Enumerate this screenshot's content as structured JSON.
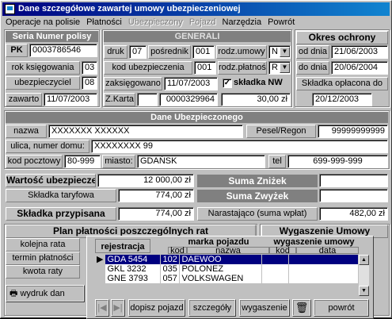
{
  "window": {
    "title": "Dane szczegółowe zawartej umowy ubezpieczeniowej"
  },
  "menu": [
    "Operacje na polisie",
    "Płatności",
    "Ubezpieczony",
    "Pojazd",
    "Narzędzia",
    "Powrót"
  ],
  "menu_disabled": [
    false,
    false,
    true,
    true,
    false,
    false
  ],
  "policy": {
    "header": "Seria Numer polisy",
    "series": "PK",
    "number": "0003786546",
    "rok_label": "rok księgowania",
    "rok": "03",
    "ubezp_label": "ubezpieczyciel",
    "ubezp": "08",
    "zawarto_label": "zawarto",
    "zawarto": "11/07/2003"
  },
  "general": {
    "header": "GENERALI",
    "druk_label": "druk",
    "druk": "07",
    "posrednik_label": "pośrednik",
    "posrednik": "001",
    "rodz_umowy_label": "rodz.umowy",
    "rodz_umowy": "N",
    "kod_ubezp_label": "kod ubezpieczenia",
    "kod_ubezp": "001",
    "rodz_platnosci_label": "rodz.płatności",
    "rodz_platnosci": "R",
    "zaksiegowano_label": "zaksięgowano",
    "zaksiegowano": "11/07/2003",
    "skladka_nw_label": "składka NW",
    "zkarta_label": "Z.Karta",
    "zkarta": "0000329964",
    "kwota": "30,00 zł"
  },
  "okres": {
    "header": "Okres ochrony",
    "od_label": "od dnia",
    "od": "21/06/2003",
    "do_label": "do dnia",
    "do": "20/06/2004",
    "oplacona_label": "Składka opłacona do",
    "oplacona": "20/12/2003"
  },
  "ubezpieczony": {
    "header": "Dane Ubezpieczonego",
    "nazwa_label": "nazwa",
    "nazwa": "XXXXXXX XXXXXX",
    "pesel_label": "Pesel/Regon",
    "pesel": "99999999999",
    "ulica_label": "ulica, numer domu:",
    "ulica_mask": "XXXXXXXX",
    "ulica_nr": "99",
    "kod_label": "kod pocztowy",
    "kod": "80-999",
    "miasto_label": "miasto:",
    "miasto": "GDAŃSK",
    "tel_label": "tel",
    "tel": "699-999-999"
  },
  "finanse": {
    "wartosc_label": "Wartość ubezpieczenia",
    "wartosc": "12 000,00 zł",
    "taryfowa_label": "Składka taryfowa",
    "taryfowa": "774,00 zł",
    "znizek_label": "Suma Zniżek",
    "zwyzek_label": "Suma Zwyżek",
    "przypisana_label": "Składka przypisana",
    "przypisana": "774,00 zł",
    "narastajaco_label": "Narastająco (suma wpłat)",
    "narastajaco": "482,00 zł"
  },
  "plan": {
    "header": "Plan płatności poszczególnych rat",
    "kolejna": "kolejna rata",
    "termin": "termin płatności",
    "kwota": "kwota raty",
    "wydruk": "wydruk dan"
  },
  "wygaszenie_header": "Wygaszenie Umowy",
  "popup": {
    "col_rej": "rejestracja",
    "col_marka": "marka pojazdu",
    "col_wyg": "wygaszenie umowy",
    "sub_kod": "kod",
    "sub_nazwa": "nazwa",
    "sub_kod2": "kod",
    "sub_data": "data",
    "rows": [
      {
        "rej": "GDA 5454",
        "kod": "102",
        "nazwa": "DAEWOO",
        "wkod": "",
        "data": ""
      },
      {
        "rej": "GKL 3232",
        "kod": "035",
        "nazwa": "POLONEZ",
        "wkod": "",
        "data": ""
      },
      {
        "rej": "GNE 3793",
        "kod": "057",
        "nazwa": "VOLKSWAGEN",
        "wkod": "",
        "data": ""
      }
    ],
    "btn_dopisz": "dopisz pojazd",
    "btn_szczegoly": "szczegóły",
    "btn_wygaszenie": "wygaszenie",
    "btn_powrot": "powrót"
  },
  "colors": {
    "title_bar": "#000080",
    "header_bg": "#808080",
    "selected_row": "#000080"
  }
}
